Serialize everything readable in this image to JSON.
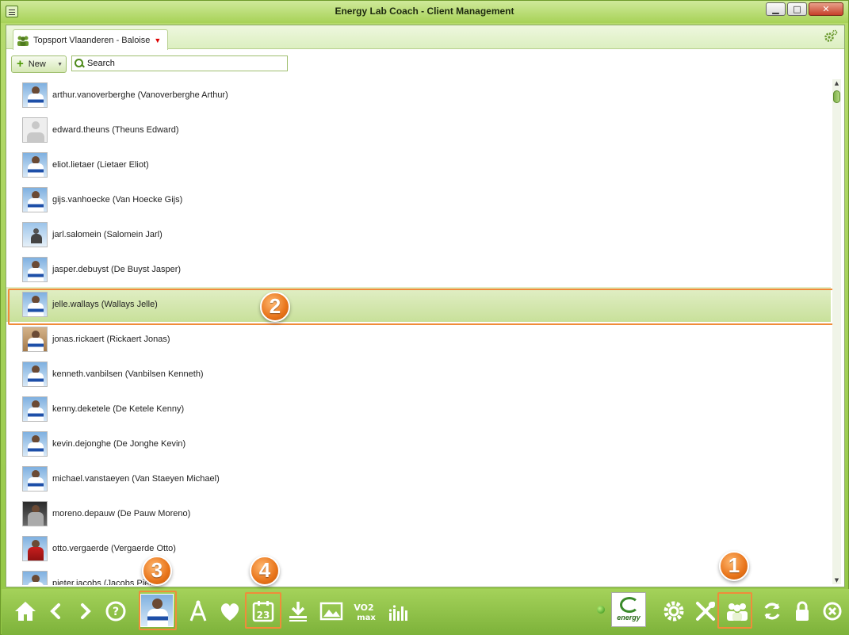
{
  "window": {
    "title": "Energy Lab Coach - Client Management",
    "minimize_glyph": "▁",
    "maximize_glyph": "□",
    "close_glyph": "✕"
  },
  "tab": {
    "label": "Topsport Vlaanderen - Baloise",
    "caret": "▼"
  },
  "toolbar": {
    "new_label": "New",
    "new_dropdown": "▼",
    "search_placeholder": "Search"
  },
  "clients": [
    {
      "label": "arthur.vanoverberghe (Vanoverberghe Arthur)",
      "avatar": "team"
    },
    {
      "label": "edward.theuns (Theuns Edward)",
      "avatar": "placeholder"
    },
    {
      "label": "eliot.lietaer (Lietaer Eliot)",
      "avatar": "team"
    },
    {
      "label": "gijs.vanhoecke (Van Hoecke Gijs)",
      "avatar": "team"
    },
    {
      "label": "jarl.salomein (Salomein Jarl)",
      "avatar": "bike"
    },
    {
      "label": "jasper.debuyst (De Buyst Jasper)",
      "avatar": "team"
    },
    {
      "label": "jelle.wallays (Wallays Jelle)",
      "avatar": "team",
      "selected": true
    },
    {
      "label": "jonas.rickaert (Rickaert Jonas)",
      "avatar": "orange"
    },
    {
      "label": "kenneth.vanbilsen (Vanbilsen Kenneth)",
      "avatar": "team"
    },
    {
      "label": "kenny.deketele (De Ketele Kenny)",
      "avatar": "team"
    },
    {
      "label": "kevin.dejonghe (De Jonghe Kevin)",
      "avatar": "team"
    },
    {
      "label": "michael.vanstaeyen (Van Staeyen Michael)",
      "avatar": "team"
    },
    {
      "label": "moreno.depauw (De Pauw Moreno)",
      "avatar": "dark"
    },
    {
      "label": "otto.vergaerde (Vergaerde Otto)",
      "avatar": "red"
    },
    {
      "label": "pieter.jacobs (Jacobs Pieter)",
      "avatar": "team"
    }
  ],
  "callouts": {
    "one": "1",
    "two": "2",
    "three": "3",
    "four": "4"
  },
  "dock": {
    "calendar_day": "23",
    "vo2_top": "VO2",
    "vo2_bottom": "max",
    "energy_label": "energy"
  },
  "colors": {
    "accent_green": "#8fbf3f",
    "selection": "#c8e09a",
    "callout_orange": "#f08c3a"
  },
  "icons": [
    "home-icon",
    "back-icon",
    "forward-icon",
    "help-icon",
    "athlete-avatar",
    "compass-icon",
    "heart-icon",
    "calendar-icon",
    "download-icon",
    "image-icon",
    "vo2max-icon",
    "stats-icon",
    "energy-logo",
    "settings-gear-icon",
    "tools-icon",
    "clients-group-icon",
    "sync-icon",
    "lock-icon",
    "exit-icon"
  ]
}
